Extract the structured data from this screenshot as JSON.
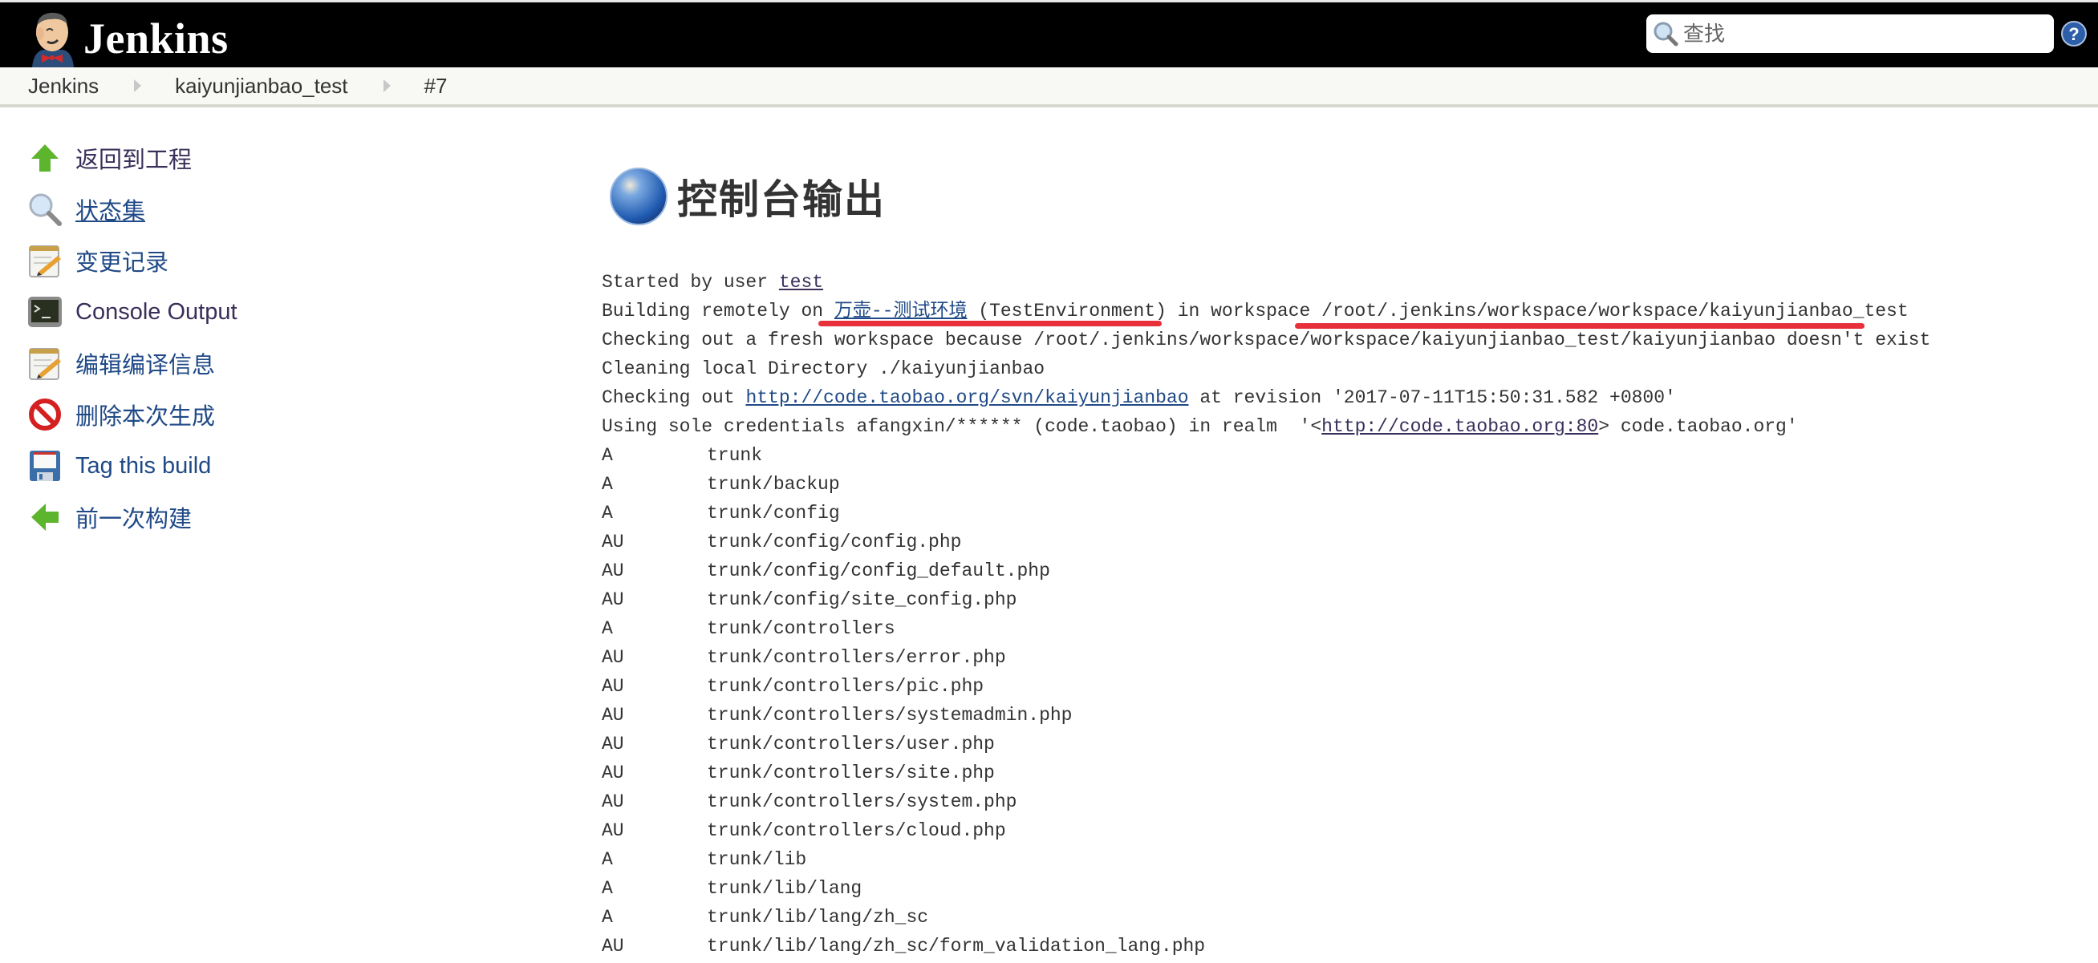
{
  "header": {
    "logo_title": "Jenkins",
    "search": {
      "placeholder": "查找",
      "value": ""
    },
    "help_icon": "help-icon"
  },
  "breadcrumbs": [
    {
      "label": "Jenkins"
    },
    {
      "label": "kaiyunjianbao_test"
    },
    {
      "label": "#7"
    }
  ],
  "sidebar": {
    "items": [
      {
        "label": "返回到工程",
        "icon": "up-arrow-icon"
      },
      {
        "label": "状态集",
        "icon": "search-icon"
      },
      {
        "label": "变更记录",
        "icon": "notepad-icon"
      },
      {
        "label": "Console Output",
        "icon": "terminal-icon"
      },
      {
        "label": "编辑编译信息",
        "icon": "notepad-icon"
      },
      {
        "label": "删除本次生成",
        "icon": "no-entry-icon"
      },
      {
        "label": "Tag this build",
        "icon": "floppy-icon"
      },
      {
        "label": "前一次构建",
        "icon": "left-arrow-icon"
      }
    ]
  },
  "main": {
    "title": "控制台输出",
    "console": {
      "started_prefix": "Started by user ",
      "started_user": "test",
      "building_prefix": "Building remotely on ",
      "building_node": "万壶--测试环境",
      "building_suffix": " (TestEnvironment) in workspace /root/.jenkins/workspace/workspace/kaiyunjianbao_test",
      "checking_fresh": "Checking out a fresh workspace because /root/.jenkins/workspace/workspace/kaiyunjianbao_test/kaiyunjianbao doesn't exist",
      "cleaning": "Cleaning local Directory ./kaiyunjianbao",
      "checkout_prefix": "Checking out ",
      "checkout_url": "http://code.taobao.org/svn/kaiyunjianbao",
      "checkout_suffix": " at revision '2017-07-11T15:50:31.582 +0800'",
      "credentials_prefix": "Using sole credentials afangxin/****** (code.taobao) in realm  '<",
      "credentials_url": "http://code.taobao.org:80",
      "credentials_suffix": "> code.taobao.org'",
      "files": [
        {
          "status": "A",
          "path": "trunk"
        },
        {
          "status": "A",
          "path": "trunk/backup"
        },
        {
          "status": "A",
          "path": "trunk/config"
        },
        {
          "status": "AU",
          "path": "trunk/config/config.php"
        },
        {
          "status": "AU",
          "path": "trunk/config/config_default.php"
        },
        {
          "status": "AU",
          "path": "trunk/config/site_config.php"
        },
        {
          "status": "A",
          "path": "trunk/controllers"
        },
        {
          "status": "AU",
          "path": "trunk/controllers/error.php"
        },
        {
          "status": "AU",
          "path": "trunk/controllers/pic.php"
        },
        {
          "status": "AU",
          "path": "trunk/controllers/systemadmin.php"
        },
        {
          "status": "AU",
          "path": "trunk/controllers/user.php"
        },
        {
          "status": "AU",
          "path": "trunk/controllers/site.php"
        },
        {
          "status": "AU",
          "path": "trunk/controllers/system.php"
        },
        {
          "status": "AU",
          "path": "trunk/controllers/cloud.php"
        },
        {
          "status": "A",
          "path": "trunk/lib"
        },
        {
          "status": "A",
          "path": "trunk/lib/lang"
        },
        {
          "status": "A",
          "path": "trunk/lib/lang/zh_sc"
        },
        {
          "status": "AU",
          "path": "trunk/lib/lang/zh_sc/form_validation_lang.php"
        }
      ]
    }
  },
  "colors": {
    "header_bg": "#000000",
    "link": "#204a87",
    "annotation_red": "#e8303a"
  }
}
